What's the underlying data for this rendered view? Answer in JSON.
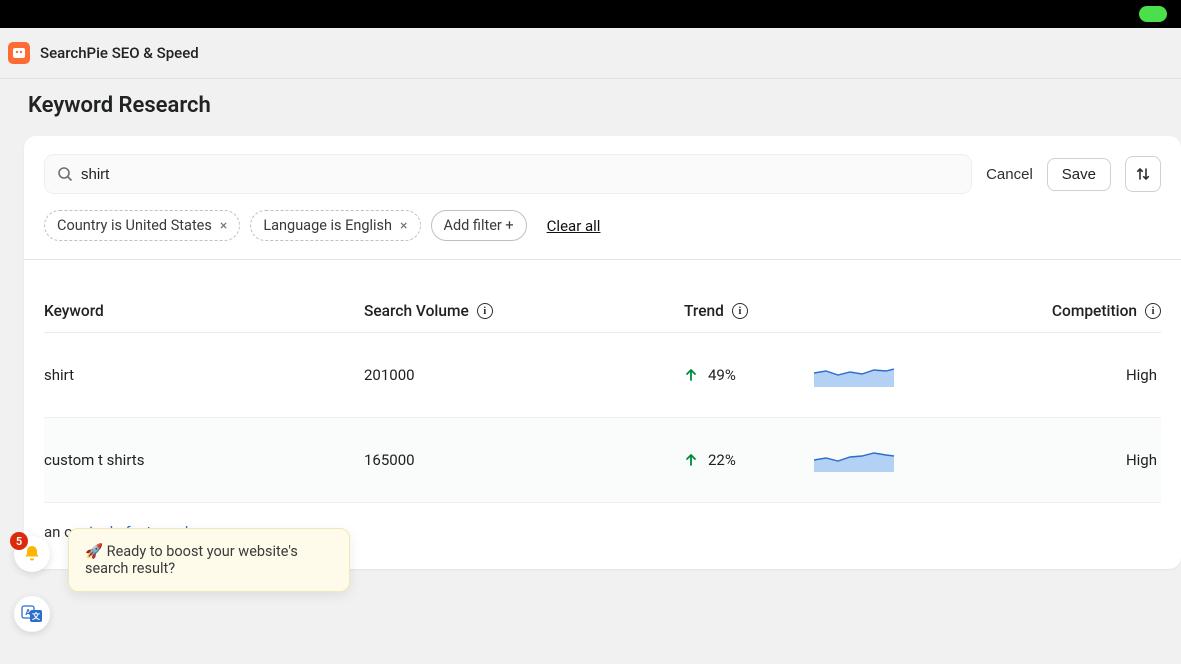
{
  "app_name": "SearchPie SEO & Speed",
  "page_title": "Keyword Research",
  "search": {
    "value": "shirt"
  },
  "actions": {
    "cancel": "Cancel",
    "save": "Save"
  },
  "filters": {
    "chips": [
      {
        "label": "Country is United States",
        "removable": true
      },
      {
        "label": "Language is English",
        "removable": true
      }
    ],
    "add_filter": "Add filter +",
    "clear_all": "Clear all"
  },
  "table": {
    "headers": {
      "keyword": "Keyword",
      "search_volume": "Search Volume",
      "trend": "Trend",
      "competition": "Competition"
    },
    "rows": [
      {
        "keyword": "shirt",
        "search_volume": "201000",
        "trend_pct": "49%",
        "competition": "High"
      },
      {
        "keyword": "custom t shirts",
        "search_volume": "165000",
        "trend_pct": "22%",
        "competition": "High"
      }
    ]
  },
  "upgrade": {
    "or": " or ",
    "link2": "single-feature plan",
    "suffix": "."
  },
  "toast": {
    "text": "🚀 Ready to boost your website's search result?"
  },
  "notifications": {
    "count": "5"
  }
}
